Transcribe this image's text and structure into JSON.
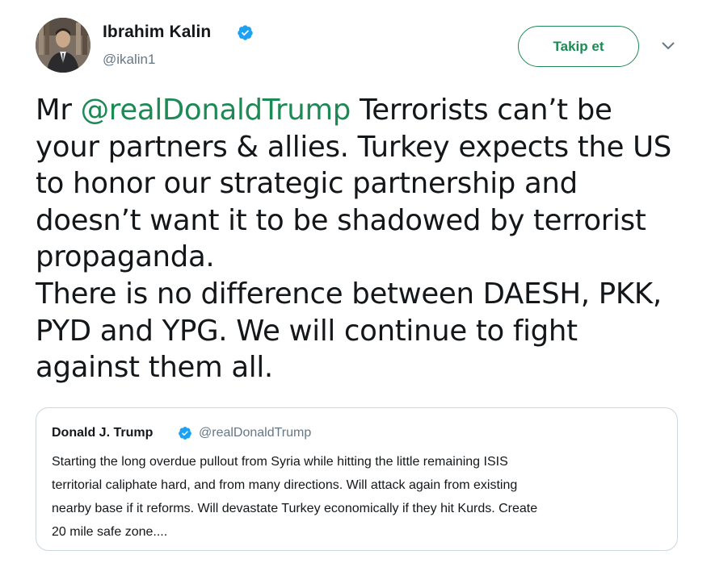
{
  "author": {
    "name": "Ibrahim Kalin",
    "handle": "@ikalin1",
    "verified": true
  },
  "follow_button": {
    "label": "Takip et"
  },
  "menu": {
    "icon": "chevron-down-icon"
  },
  "tweet": {
    "lines": [
      {
        "mention": "@realDonaldTrump",
        "prefix": "Mr ",
        "suffix": " Terrorists can’t be"
      },
      "your partners & allies. Turkey expects the US",
      "to honor our strategic partnership and",
      "doesn’t want it to be shadowed by terrorist",
      "propaganda.",
      "There is no difference between DAESH, PKK,",
      "PYD and YPG. We will continue to fight",
      "against them all."
    ]
  },
  "quoted": {
    "name": "Donald J. Trump",
    "handle": "@realDonaldTrump",
    "verified": true,
    "lines": [
      "Starting the long overdue pullout from Syria while hitting the little remaining ISIS",
      "territorial caliphate hard, and from many directions. Will attack again from existing",
      "nearby base if it reforms. Will devastate Turkey economically if they hit Kurds. Create",
      "20 mile safe zone...."
    ]
  },
  "colors": {
    "accent": "#1d8a55",
    "verified": "#1da1f2",
    "secondary_text": "#657786",
    "border": "#ccd6dd"
  }
}
